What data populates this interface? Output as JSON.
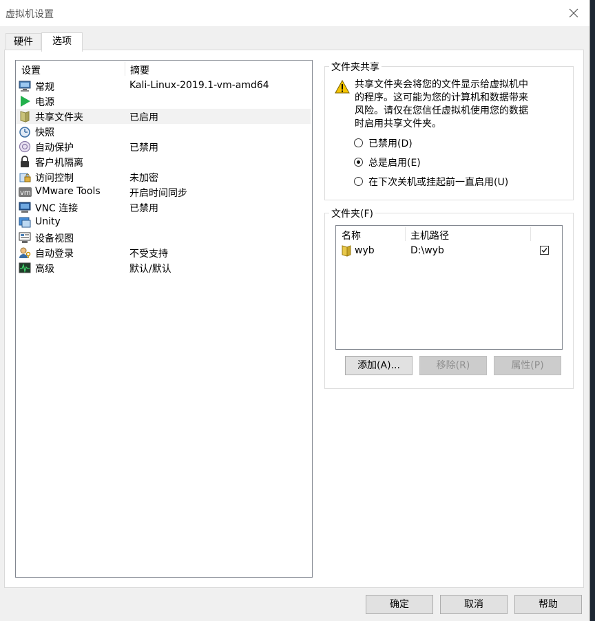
{
  "window": {
    "title": "虚拟机设置",
    "close_label": "×"
  },
  "tabs": [
    {
      "label": "硬件",
      "active": false
    },
    {
      "label": "选项",
      "active": true
    }
  ],
  "settings_list": {
    "columns": {
      "setting": "设置",
      "summary": "摘要"
    },
    "items": [
      {
        "label": "常规",
        "summary": "Kali-Linux-2019.1-vm-amd64",
        "icon": "general-icon"
      },
      {
        "label": "电源",
        "summary": "",
        "icon": "power-icon"
      },
      {
        "label": "共享文件夹",
        "summary": "已启用",
        "icon": "shared-folder-icon",
        "selected": true
      },
      {
        "label": "快照",
        "summary": "",
        "icon": "snapshot-icon"
      },
      {
        "label": "自动保护",
        "summary": "已禁用",
        "icon": "autoprotect-icon"
      },
      {
        "label": "客户机隔离",
        "summary": "",
        "icon": "lock-icon"
      },
      {
        "label": "访问控制",
        "summary": "未加密",
        "icon": "access-control-icon"
      },
      {
        "label": "VMware Tools",
        "summary": "开启时间同步",
        "icon": "vmware-tools-icon"
      },
      {
        "label": "VNC 连接",
        "summary": "已禁用",
        "icon": "vnc-icon"
      },
      {
        "label": "Unity",
        "summary": "",
        "icon": "unity-icon"
      },
      {
        "label": "设备视图",
        "summary": "",
        "icon": "device-view-icon"
      },
      {
        "label": "自动登录",
        "summary": "不受支持",
        "icon": "autologin-icon"
      },
      {
        "label": "高级",
        "summary": "默认/默认",
        "icon": "advanced-icon"
      }
    ]
  },
  "folder_sharing": {
    "title": "文件夹共享",
    "warning_lines": [
      "共享文件夹会将您的文件显示给虚拟机中",
      "的程序。这可能为您的计算机和数据带来",
      "风险。请仅在您信任虚拟机使用您的数据",
      "时启用共享文件夹。"
    ],
    "options": [
      {
        "label": "已禁用(D)",
        "checked": false
      },
      {
        "label": "总是启用(E)",
        "checked": true
      },
      {
        "label": "在下次关机或挂起前一直启用(U)",
        "checked": false
      }
    ]
  },
  "folders": {
    "title": "文件夹(F)",
    "columns": {
      "name": "名称",
      "path": "主机路径"
    },
    "rows": [
      {
        "name": "wyb",
        "path": "D:\\wyb",
        "enabled": true
      }
    ],
    "buttons": {
      "add": "添加(A)...",
      "remove": "移除(R)",
      "properties": "属性(P)"
    }
  },
  "footer": {
    "ok": "确定",
    "cancel": "取消",
    "help": "帮助"
  },
  "colors": {
    "accent": "#0078d7",
    "selected_row": "#f2f2f2",
    "warning": "#f5c400",
    "power": "#22b14c"
  }
}
